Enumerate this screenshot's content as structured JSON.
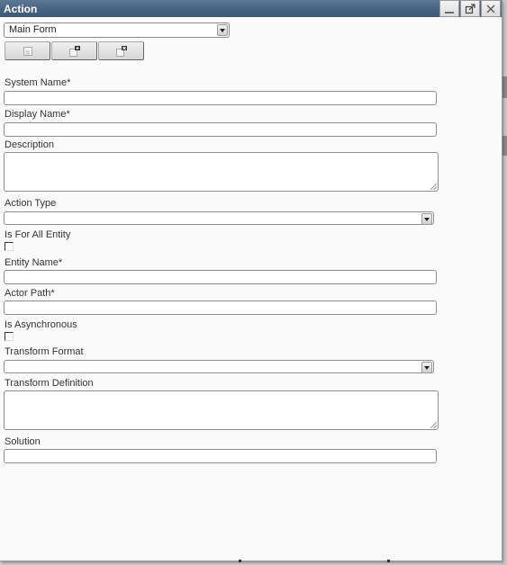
{
  "window": {
    "title": "Action",
    "buttons": [
      "minimize",
      "pop-out",
      "close"
    ]
  },
  "form_selector": {
    "selected": "Main Form"
  },
  "toolbar": {
    "buttons": [
      {
        "icon": "form-icon",
        "tooltip": ""
      },
      {
        "icon": "add-form-icon",
        "tooltip": ""
      },
      {
        "icon": "delete-form-icon",
        "tooltip": ""
      }
    ]
  },
  "fields": {
    "system_name": {
      "label": "System Name*",
      "value": ""
    },
    "display_name": {
      "label": "Display Name*",
      "value": ""
    },
    "description": {
      "label": "Description",
      "value": ""
    },
    "action_type": {
      "label": "Action Type",
      "value": ""
    },
    "is_for_all_entity": {
      "label": "Is For All Entity",
      "checked": false
    },
    "entity_name": {
      "label": "Entity Name*",
      "value": ""
    },
    "actor_path": {
      "label": "Actor Path*",
      "value": ""
    },
    "is_asynchronous": {
      "label": "Is Asynchronous",
      "checked": false
    },
    "transform_format": {
      "label": "Transform Format",
      "value": ""
    },
    "transform_definition": {
      "label": "Transform Definition",
      "value": ""
    },
    "solution": {
      "label": "Solution",
      "value": ""
    }
  },
  "colors": {
    "titlebar": "#4a6582",
    "window_bg": "#fafafa"
  }
}
